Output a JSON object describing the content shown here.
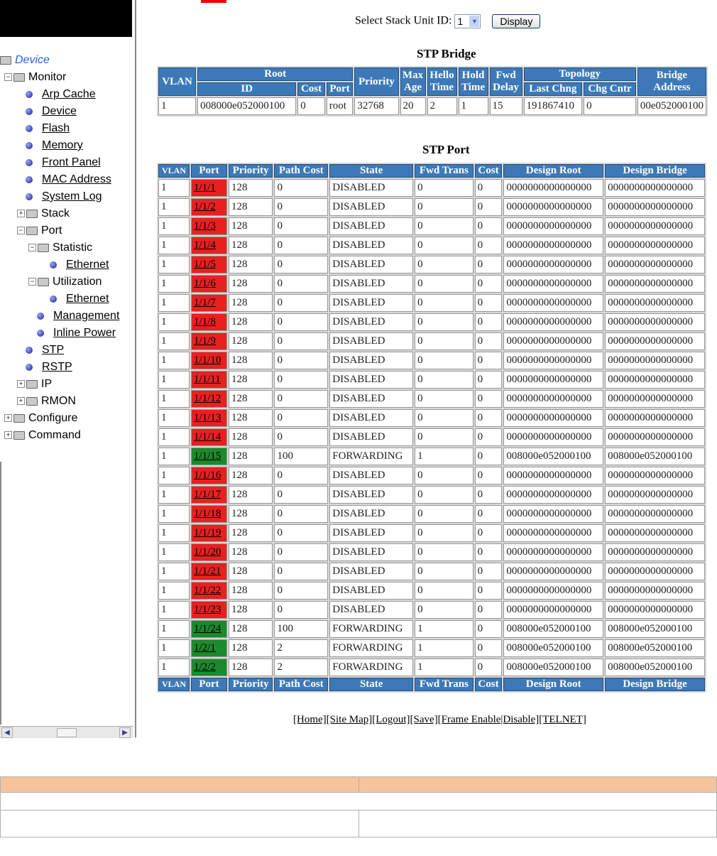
{
  "nav": {
    "tree": [
      {
        "label": "Device",
        "type": "root"
      },
      {
        "label": "Monitor",
        "type": "folder-open"
      },
      {
        "label": "Arp Cache",
        "type": "leaf"
      },
      {
        "label": "Device",
        "type": "leaf"
      },
      {
        "label": "Flash",
        "type": "leaf"
      },
      {
        "label": "Memory",
        "type": "leaf"
      },
      {
        "label": "Front Panel",
        "type": "leaf"
      },
      {
        "label": "MAC Address",
        "type": "leaf"
      },
      {
        "label": "System Log",
        "type": "leaf"
      },
      {
        "label": "Stack",
        "type": "folder-closed"
      },
      {
        "label": "Port",
        "type": "folder-open"
      },
      {
        "label": "Statistic",
        "type": "folder-open"
      },
      {
        "label": "Ethernet",
        "type": "leaf"
      },
      {
        "label": "Utilization",
        "type": "folder-open"
      },
      {
        "label": "Ethernet",
        "type": "leaf"
      },
      {
        "label": "Management",
        "type": "leaf"
      },
      {
        "label": "Inline Power",
        "type": "leaf"
      },
      {
        "label": "STP",
        "type": "leaf"
      },
      {
        "label": "RSTP",
        "type": "leaf"
      },
      {
        "label": "IP",
        "type": "folder-closed"
      },
      {
        "label": "RMON",
        "type": "folder-closed"
      },
      {
        "label": "Configure",
        "type": "folder-closed"
      },
      {
        "label": "Command",
        "type": "folder-closed"
      }
    ]
  },
  "stack_select": {
    "label": "Select Stack Unit ID:",
    "value": "1",
    "button": "Display"
  },
  "bridge": {
    "title": "STP Bridge",
    "headers": {
      "vlan": "VLAN",
      "root": "Root",
      "id": "ID",
      "cost": "Cost",
      "port": "Port",
      "priority": "Priority",
      "max_age": "Max Age",
      "hello_time": "Hello Time",
      "hold_time": "Hold Time",
      "fwd_delay": "Fwd Delay",
      "topology": "Topology",
      "last_chng": "Last Chng",
      "chg_cntr": "Chg Cntr",
      "bridge_address": "Bridge Address"
    },
    "row": [
      "1",
      "008000e052000100",
      "0",
      "root",
      "32768",
      "20",
      "2",
      "1",
      "15",
      "191867410",
      "0",
      "00e052000100"
    ]
  },
  "port": {
    "title": "STP Port",
    "headers": [
      "VLAN",
      "Port",
      "Priority",
      "Path Cost",
      "State",
      "Fwd Trans",
      "Cost",
      "Design Root",
      "Design Bridge"
    ],
    "rows": [
      [
        "1",
        "1/1/1",
        "128",
        "0",
        "DISABLED",
        "0",
        "0",
        "0000000000000000",
        "0000000000000000"
      ],
      [
        "1",
        "1/1/2",
        "128",
        "0",
        "DISABLED",
        "0",
        "0",
        "0000000000000000",
        "0000000000000000"
      ],
      [
        "1",
        "1/1/3",
        "128",
        "0",
        "DISABLED",
        "0",
        "0",
        "0000000000000000",
        "0000000000000000"
      ],
      [
        "1",
        "1/1/4",
        "128",
        "0",
        "DISABLED",
        "0",
        "0",
        "0000000000000000",
        "0000000000000000"
      ],
      [
        "1",
        "1/1/5",
        "128",
        "0",
        "DISABLED",
        "0",
        "0",
        "0000000000000000",
        "0000000000000000"
      ],
      [
        "1",
        "1/1/6",
        "128",
        "0",
        "DISABLED",
        "0",
        "0",
        "0000000000000000",
        "0000000000000000"
      ],
      [
        "1",
        "1/1/7",
        "128",
        "0",
        "DISABLED",
        "0",
        "0",
        "0000000000000000",
        "0000000000000000"
      ],
      [
        "1",
        "1/1/8",
        "128",
        "0",
        "DISABLED",
        "0",
        "0",
        "0000000000000000",
        "0000000000000000"
      ],
      [
        "1",
        "1/1/9",
        "128",
        "0",
        "DISABLED",
        "0",
        "0",
        "0000000000000000",
        "0000000000000000"
      ],
      [
        "1",
        "1/1/10",
        "128",
        "0",
        "DISABLED",
        "0",
        "0",
        "0000000000000000",
        "0000000000000000"
      ],
      [
        "1",
        "1/1/11",
        "128",
        "0",
        "DISABLED",
        "0",
        "0",
        "0000000000000000",
        "0000000000000000"
      ],
      [
        "1",
        "1/1/12",
        "128",
        "0",
        "DISABLED",
        "0",
        "0",
        "0000000000000000",
        "0000000000000000"
      ],
      [
        "1",
        "1/1/13",
        "128",
        "0",
        "DISABLED",
        "0",
        "0",
        "0000000000000000",
        "0000000000000000"
      ],
      [
        "1",
        "1/1/14",
        "128",
        "0",
        "DISABLED",
        "0",
        "0",
        "0000000000000000",
        "0000000000000000"
      ],
      [
        "1",
        "1/1/15",
        "128",
        "100",
        "FORWARDING",
        "1",
        "0",
        "008000e052000100",
        "008000e052000100"
      ],
      [
        "1",
        "1/1/16",
        "128",
        "0",
        "DISABLED",
        "0",
        "0",
        "0000000000000000",
        "0000000000000000"
      ],
      [
        "1",
        "1/1/17",
        "128",
        "0",
        "DISABLED",
        "0",
        "0",
        "0000000000000000",
        "0000000000000000"
      ],
      [
        "1",
        "1/1/18",
        "128",
        "0",
        "DISABLED",
        "0",
        "0",
        "0000000000000000",
        "0000000000000000"
      ],
      [
        "1",
        "1/1/19",
        "128",
        "0",
        "DISABLED",
        "0",
        "0",
        "0000000000000000",
        "0000000000000000"
      ],
      [
        "1",
        "1/1/20",
        "128",
        "0",
        "DISABLED",
        "0",
        "0",
        "0000000000000000",
        "0000000000000000"
      ],
      [
        "1",
        "1/1/21",
        "128",
        "0",
        "DISABLED",
        "0",
        "0",
        "0000000000000000",
        "0000000000000000"
      ],
      [
        "1",
        "1/1/22",
        "128",
        "0",
        "DISABLED",
        "0",
        "0",
        "0000000000000000",
        "0000000000000000"
      ],
      [
        "1",
        "1/1/23",
        "128",
        "0",
        "DISABLED",
        "0",
        "0",
        "0000000000000000",
        "0000000000000000"
      ],
      [
        "1",
        "1/1/24",
        "128",
        "100",
        "FORWARDING",
        "1",
        "0",
        "008000e052000100",
        "008000e052000100"
      ],
      [
        "1",
        "1/2/1",
        "128",
        "2",
        "FORWARDING",
        "1",
        "0",
        "008000e052000100",
        "008000e052000100"
      ],
      [
        "1",
        "1/2/2",
        "128",
        "2",
        "FORWARDING",
        "1",
        "0",
        "008000e052000100",
        "008000e052000100"
      ]
    ]
  },
  "footer_links": "[Home][Site Map][Logout][Save][Frame Enable|Disable][TELNET]",
  "colors": {
    "header_blue": "#3d79b8",
    "port_disabled": "#e82020",
    "port_forwarding": "#1a8a2a",
    "doc_header": "#f6c49a"
  },
  "icons": [
    "folder-icon",
    "expand-icon",
    "bullet-icon",
    "scroll-left-icon",
    "scroll-right-icon",
    "dropdown-arrow-icon"
  ]
}
